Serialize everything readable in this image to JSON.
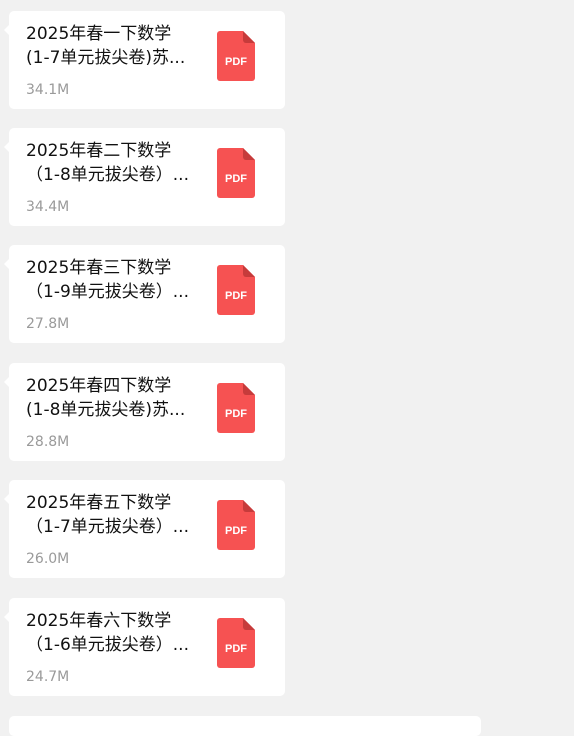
{
  "files": [
    {
      "name": "2025年春一下数学\n(1-7单元拔尖卷)苏...",
      "size": "34.1M",
      "icon": "pdf-file-icon",
      "icon_label": "PDF"
    },
    {
      "name": "2025年春二下数学\n（1-8单元拔尖卷）...",
      "size": "34.4M",
      "icon": "pdf-file-icon",
      "icon_label": "PDF"
    },
    {
      "name": "2025年春三下数学\n（1-9单元拔尖卷）...",
      "size": "27.8M",
      "icon": "pdf-file-icon",
      "icon_label": "PDF"
    },
    {
      "name": "2025年春四下数学\n(1-8单元拔尖卷)苏...",
      "size": "28.8M",
      "icon": "pdf-file-icon",
      "icon_label": "PDF"
    },
    {
      "name": "2025年春五下数学\n（1-7单元拔尖卷）...",
      "size": "26.0M",
      "icon": "pdf-file-icon",
      "icon_label": "PDF"
    },
    {
      "name": "2025年春六下数学\n（1-6单元拔尖卷）...",
      "size": "24.7M",
      "icon": "pdf-file-icon",
      "icon_label": "PDF"
    }
  ],
  "colors": {
    "background": "#f1f1f1",
    "card": "#ffffff",
    "pdf_red": "#f65252",
    "pdf_fold": "#c63b3b",
    "size_text": "#9a9a9a"
  }
}
